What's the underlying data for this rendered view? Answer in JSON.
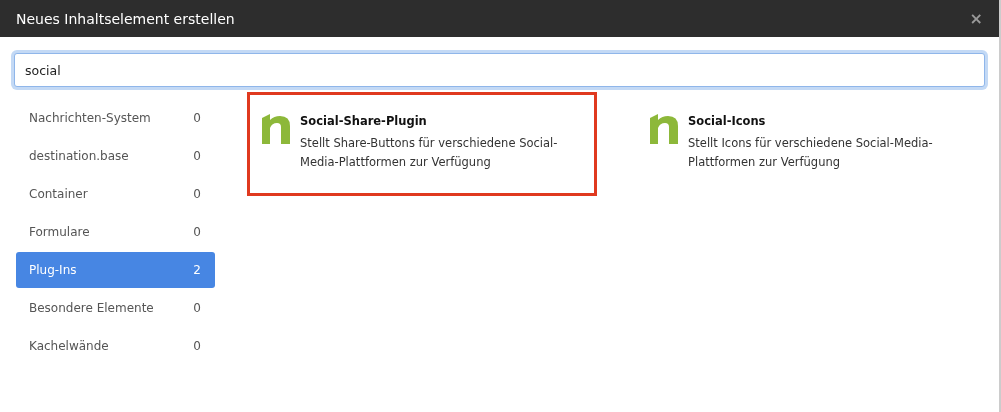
{
  "window": {
    "title": "Neues Inhaltselement erstellen",
    "close": "×"
  },
  "search": {
    "value": "social"
  },
  "categories": [
    {
      "label": "Nachrichten-System",
      "count": "0",
      "selected": false
    },
    {
      "label": "destination.base",
      "count": "0",
      "selected": false
    },
    {
      "label": "Container",
      "count": "0",
      "selected": false
    },
    {
      "label": "Formulare",
      "count": "0",
      "selected": false
    },
    {
      "label": "Plug-Ins",
      "count": "2",
      "selected": true
    },
    {
      "label": "Besondere Elemente",
      "count": "0",
      "selected": false
    },
    {
      "label": "Kachelwände",
      "count": "0",
      "selected": false
    }
  ],
  "elements": [
    {
      "title": "Social-Share-Plugin",
      "description": "Stellt Share-Buttons für verschiedene Social-Media-Plattformen zur Verfügung",
      "highlighted": true
    },
    {
      "title": "Social-Icons",
      "description": "Stellt Icons für verschiedene Social-Media-Plattformen zur Verfügung",
      "highlighted": false
    }
  ]
}
